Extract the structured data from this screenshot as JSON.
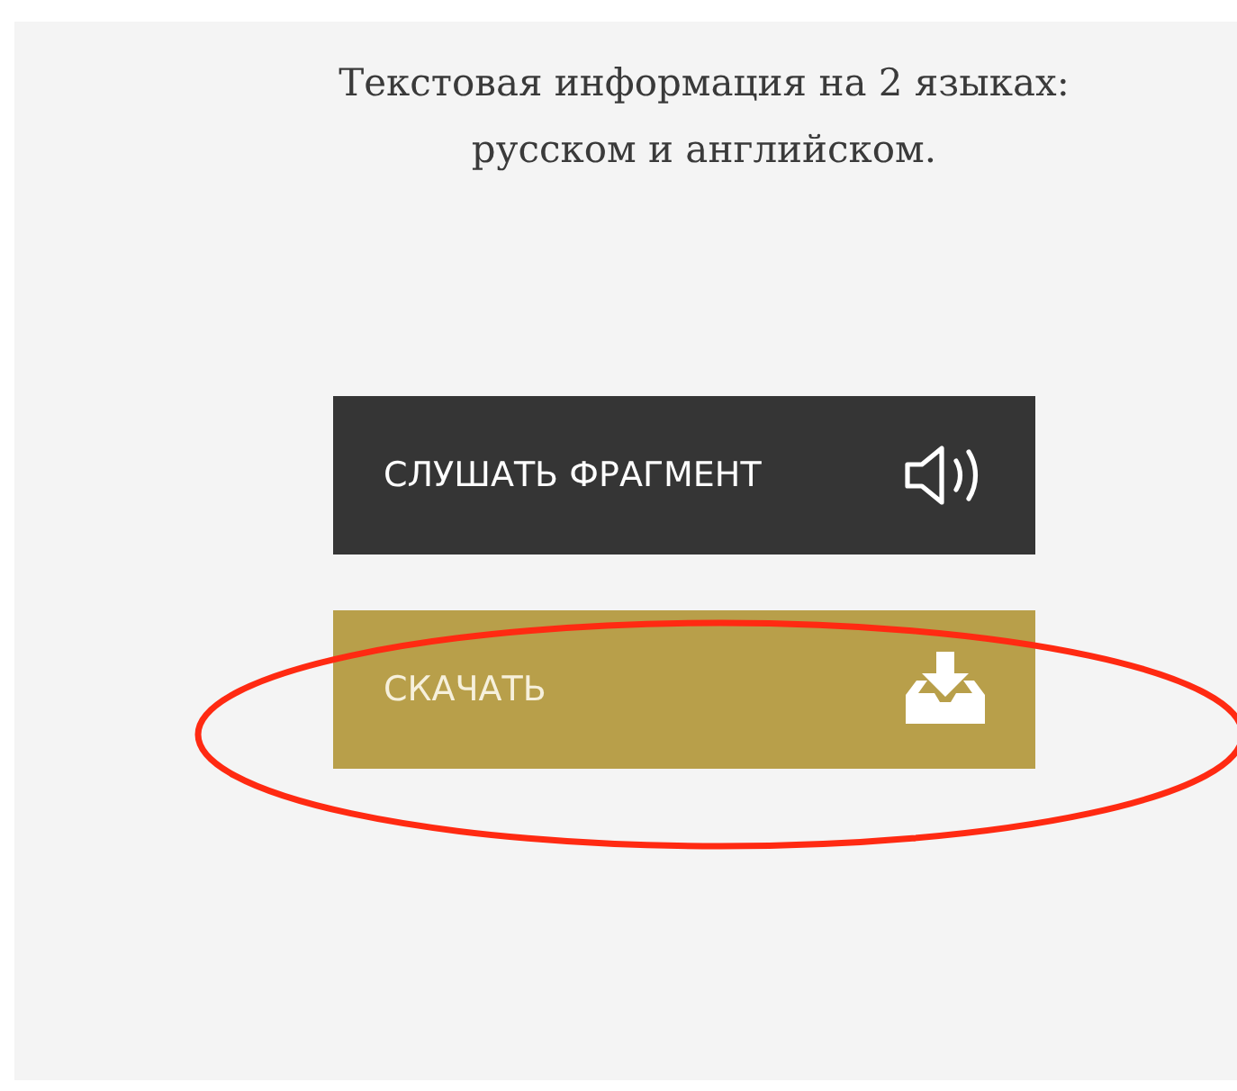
{
  "description": {
    "lines": [
      "Текстовая информация на 2 языках:",
      "русском и английском."
    ]
  },
  "buttons": [
    {
      "kind": "listen",
      "label": "СЛУШАТЬ ФРАГМЕНТ"
    },
    {
      "kind": "download",
      "label": "СКАЧАТЬ"
    }
  ],
  "highlight": {
    "kind": "ellipse"
  }
}
